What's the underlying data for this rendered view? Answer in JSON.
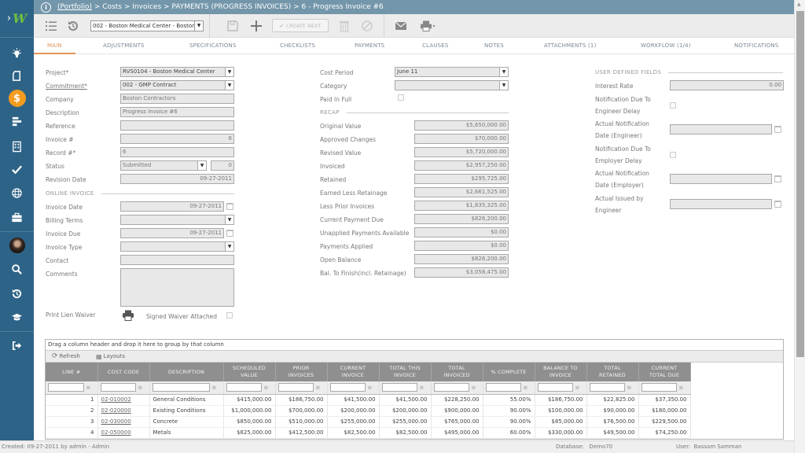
{
  "app": {
    "logo_text": "W",
    "expand_icon": "chevron-right-icon"
  },
  "sidebar": {
    "items": [
      {
        "name": "lightbulb-icon",
        "label": "Ideas"
      },
      {
        "name": "document-icon",
        "label": "Documents"
      },
      {
        "name": "dollar-icon",
        "label": "Costs",
        "active": true
      },
      {
        "name": "gantt-icon",
        "label": "Schedule"
      },
      {
        "name": "building-icon",
        "label": "Assets"
      },
      {
        "name": "check-icon",
        "label": "Tasks"
      },
      {
        "name": "globe-icon",
        "label": "Portal"
      },
      {
        "name": "briefcase-icon",
        "label": "Portfolio"
      },
      {
        "name": "avatar",
        "label": "User"
      },
      {
        "name": "search-icon",
        "label": "Search"
      },
      {
        "name": "history-icon",
        "label": "History"
      },
      {
        "name": "graduation-cap-icon",
        "label": "Learning"
      },
      {
        "name": "logout-icon",
        "label": "Logout"
      }
    ],
    "accent_color": "#f39c1f"
  },
  "breadcrumb": {
    "portfolio_link": "(Portfolio)",
    "rest": " > Costs > Invoices > PAYMENTS (PROGRESS INVOICES) > 6 - Progress Invoice #6"
  },
  "toolbar": {
    "project_select": "002 - Boston Medical Center - Boston",
    "create_next_label": "CREATE NEXT"
  },
  "tabs": [
    {
      "label": "MAIN",
      "active": true
    },
    {
      "label": "ADJUSTMENTS"
    },
    {
      "label": "SPECIFICATIONS"
    },
    {
      "label": "CHECKLISTS"
    },
    {
      "label": "PAYMENTS"
    },
    {
      "label": "CLAUSES"
    },
    {
      "label": "NOTES"
    },
    {
      "label": "ATTACHMENTS (1)"
    },
    {
      "label": "WORKFLOW (1/4)"
    },
    {
      "label": "NOTIFICATIONS"
    }
  ],
  "form": {
    "project": {
      "label": "Project*",
      "value": "RVS0104 - Boston Medical Center"
    },
    "commitment": {
      "label": "Commitment*",
      "value": "002 - GMP Contract"
    },
    "company": {
      "label": "Company",
      "value": "Boston Contractors"
    },
    "description": {
      "label": "Description",
      "value": "Progress Invoice #6"
    },
    "reference": {
      "label": "Reference",
      "value": ""
    },
    "invoice_no": {
      "label": "Invoice #",
      "value": "6"
    },
    "record_no": {
      "label": "Record #*",
      "value": "6"
    },
    "status": {
      "label": "Status",
      "value": "Submitted",
      "number": "0"
    },
    "revision_date": {
      "label": "Revision Date",
      "value": "09-27-2011"
    },
    "online_invoice_section": "ONLINE INVOICE",
    "invoice_date": {
      "label": "Invoice Date",
      "value": "09-27-2011"
    },
    "billing_terms": {
      "label": "Billing Terms",
      "value": ""
    },
    "invoice_due": {
      "label": "Invoice Due",
      "value": "09-27-2011"
    },
    "invoice_type": {
      "label": "Invoice Type",
      "value": ""
    },
    "contact": {
      "label": "Contact",
      "value": ""
    },
    "comments": {
      "label": "Comments",
      "value": ""
    },
    "print_lien_waiver": {
      "label": "Print Lien Waiver"
    },
    "signed_waiver": {
      "label": "Signed Waiver Attached",
      "checked": false
    },
    "cost_period": {
      "label": "Cost Period",
      "value": "June 11"
    },
    "category": {
      "label": "Category",
      "value": ""
    },
    "paid_in_full": {
      "label": "Paid In Full",
      "checked": false
    },
    "recap_section": "RECAP",
    "recap": [
      {
        "label": "Original Value",
        "value": "$5,650,000.00"
      },
      {
        "label": "Approved Changes",
        "value": "$70,000.00"
      },
      {
        "label": "Revised Value",
        "value": "$5,720,000.00"
      },
      {
        "label": "Invoiced",
        "value": "$2,957,250.00"
      },
      {
        "label": "Retained",
        "value": "$295,725.00"
      },
      {
        "label": "Earned Less Retainage",
        "value": "$2,661,525.00"
      },
      {
        "label": "Less Prior Invoices",
        "value": "$1,835,325.00"
      },
      {
        "label": "Current Payment Due",
        "value": "$826,200.00"
      },
      {
        "label": "Unapplied Payments Available",
        "value": "$0.00"
      },
      {
        "label": "Payments Applied",
        "value": "$0.00"
      },
      {
        "label": "Open Balance",
        "value": "$826,200.00"
      },
      {
        "label": "Bal. To Finish(incl. Retainage)",
        "value": "$3,058,475.00"
      }
    ],
    "udf_section": "USER DEFINED FIELDS",
    "interest_rate": {
      "label": "Interest Rate",
      "value": "0.00"
    },
    "notif_engineer": {
      "label1": "Notification Due To",
      "label2": "Engineer Delay",
      "checked": false
    },
    "actual_notif_engineer": {
      "label1": "Actual Notification",
      "label2": "Date (Engineer)",
      "value": ""
    },
    "notif_employer": {
      "label1": "Notification Due To",
      "label2": "Employer Delay",
      "checked": false
    },
    "actual_notif_employer": {
      "label1": "Actual Notification",
      "label2": "Date (Employer)",
      "value": ""
    },
    "actual_issued": {
      "label1": "Actual Issued by",
      "label2": "Engineer",
      "value": ""
    }
  },
  "grid": {
    "group_hint": "Drag a column header and drop it here to group by that column",
    "refresh_label": "Refresh",
    "layouts_label": "Layouts",
    "columns": [
      {
        "l1": "LINE #",
        "l2": ""
      },
      {
        "l1": "COST CODE",
        "l2": ""
      },
      {
        "l1": "DESCRIPTION",
        "l2": ""
      },
      {
        "l1": "SCHEDULED",
        "l2": "VALUE"
      },
      {
        "l1": "PRIOR",
        "l2": "INVOICES"
      },
      {
        "l1": "CURRENT",
        "l2": "INVOICE"
      },
      {
        "l1": "TOTAL THIS",
        "l2": "INVOICE"
      },
      {
        "l1": "TOTAL",
        "l2": "INVOICED"
      },
      {
        "l1": "% COMPLETE",
        "l2": ""
      },
      {
        "l1": "BALANCE TO",
        "l2": "INVOICE"
      },
      {
        "l1": "TOTAL",
        "l2": "RETAINED"
      },
      {
        "l1": "CURRENT",
        "l2": "TOTAL DUE"
      }
    ],
    "rows": [
      [
        "1",
        "02-010002",
        "General Conditions",
        "$415,000.00",
        "$186,750.00",
        "$41,500.00",
        "$41,500.00",
        "$228,250.00",
        "55.00%",
        "$186,750.00",
        "$22,825.00",
        "$37,350.00"
      ],
      [
        "2",
        "02-020000",
        "Existing Conditions",
        "$1,000,000.00",
        "$700,000.00",
        "$200,000.00",
        "$200,000.00",
        "$900,000.00",
        "90.00%",
        "$100,000.00",
        "$90,000.00",
        "$180,000.00"
      ],
      [
        "3",
        "02-030000",
        "Concrete",
        "$850,000.00",
        "$510,000.00",
        "$255,000.00",
        "$255,000.00",
        "$765,000.00",
        "90.00%",
        "$85,000.00",
        "$76,500.00",
        "$229,500.00"
      ],
      [
        "4",
        "02-050000",
        "Metals",
        "$825,000.00",
        "$412,500.00",
        "$82,500.00",
        "$82,500.00",
        "$495,000.00",
        "60.00%",
        "$330,000.00",
        "$49,500.00",
        "$74,250.00"
      ]
    ]
  },
  "status_bar": {
    "created": "Created:  09-27-2011 by admin - Admin",
    "database": "Database:   Demo70",
    "user": "User:  Bassam Samman"
  }
}
